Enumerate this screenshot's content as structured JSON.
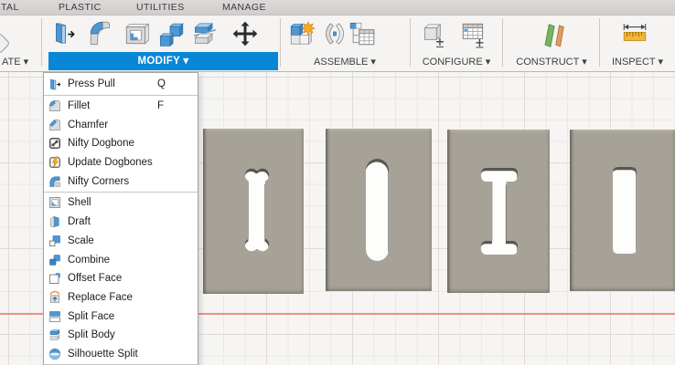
{
  "tabbar": {
    "tabs": [
      {
        "label": "TAL"
      },
      {
        "label": "PLASTIC"
      },
      {
        "label": "UTILITIES"
      },
      {
        "label": "MANAGE"
      }
    ]
  },
  "toolbar": {
    "create_group": {
      "label": "ATE ▾"
    },
    "groups": [
      {
        "id": "modify",
        "label": "MODIFY ▾",
        "icons": [
          "press-pull-icon",
          "fillet-icon",
          "shell-icon",
          "combine-icon",
          "split-body-icon",
          "move-icon"
        ]
      },
      {
        "id": "assemble",
        "label": "ASSEMBLE ▾",
        "icons": [
          "new-component-icon",
          "joint-icon",
          "bom-table-icon"
        ]
      },
      {
        "id": "configure",
        "label": "CONFIGURE ▾",
        "icons": [
          "configuration-cube-icon",
          "configuration-table-icon"
        ]
      },
      {
        "id": "construct",
        "label": "CONSTRUCT ▾",
        "icons": [
          "construction-planes-icon"
        ]
      },
      {
        "id": "inspect",
        "label": "INSPECT ▾",
        "icons": [
          "measure-icon"
        ]
      }
    ]
  },
  "modify_menu": {
    "items": [
      {
        "label": "Press Pull",
        "shortcut": "Q",
        "icon": "press-pull-icon",
        "separator_after": true
      },
      {
        "label": "Fillet",
        "shortcut": "F",
        "icon": "fillet-icon"
      },
      {
        "label": "Chamfer",
        "shortcut": "",
        "icon": "chamfer-icon"
      },
      {
        "label": "Nifty Dogbone",
        "shortcut": "",
        "icon": "nifty-dogbone-icon"
      },
      {
        "label": "Update Dogbones",
        "shortcut": "",
        "icon": "update-dogbones-icon"
      },
      {
        "label": "Nifty Corners",
        "shortcut": "",
        "icon": "nifty-corners-icon",
        "separator_after": true
      },
      {
        "label": "Shell",
        "shortcut": "",
        "icon": "shell-icon"
      },
      {
        "label": "Draft",
        "shortcut": "",
        "icon": "draft-icon"
      },
      {
        "label": "Scale",
        "shortcut": "",
        "icon": "scale-icon"
      },
      {
        "label": "Combine",
        "shortcut": "",
        "icon": "combine-icon"
      },
      {
        "label": "Offset Face",
        "shortcut": "",
        "icon": "offset-face-icon"
      },
      {
        "label": "Replace Face",
        "shortcut": "",
        "icon": "replace-face-icon"
      },
      {
        "label": "Split Face",
        "shortcut": "",
        "icon": "split-face-icon"
      },
      {
        "label": "Split Body",
        "shortcut": "",
        "icon": "split-body-icon"
      },
      {
        "label": "Silhouette Split",
        "shortcut": "",
        "icon": "silhouette-split-icon",
        "separator_after": true
      }
    ]
  },
  "viewport": {
    "bodies": [
      {
        "name": "panel-with-circular-dogbone-slot"
      },
      {
        "name": "panel-with-plain-slot"
      },
      {
        "name": "panel-with-tbone-slot"
      },
      {
        "name": "panel-with-mini-dogbone-slot"
      }
    ],
    "colors": {
      "body_fill": "#a7a297",
      "grid_minor": "#ebe9e6",
      "grid_major": "#dedbd7",
      "origin_axis": "#f0857d",
      "background": "#f6f5f3",
      "highlight_blue": "#0787d6"
    }
  }
}
